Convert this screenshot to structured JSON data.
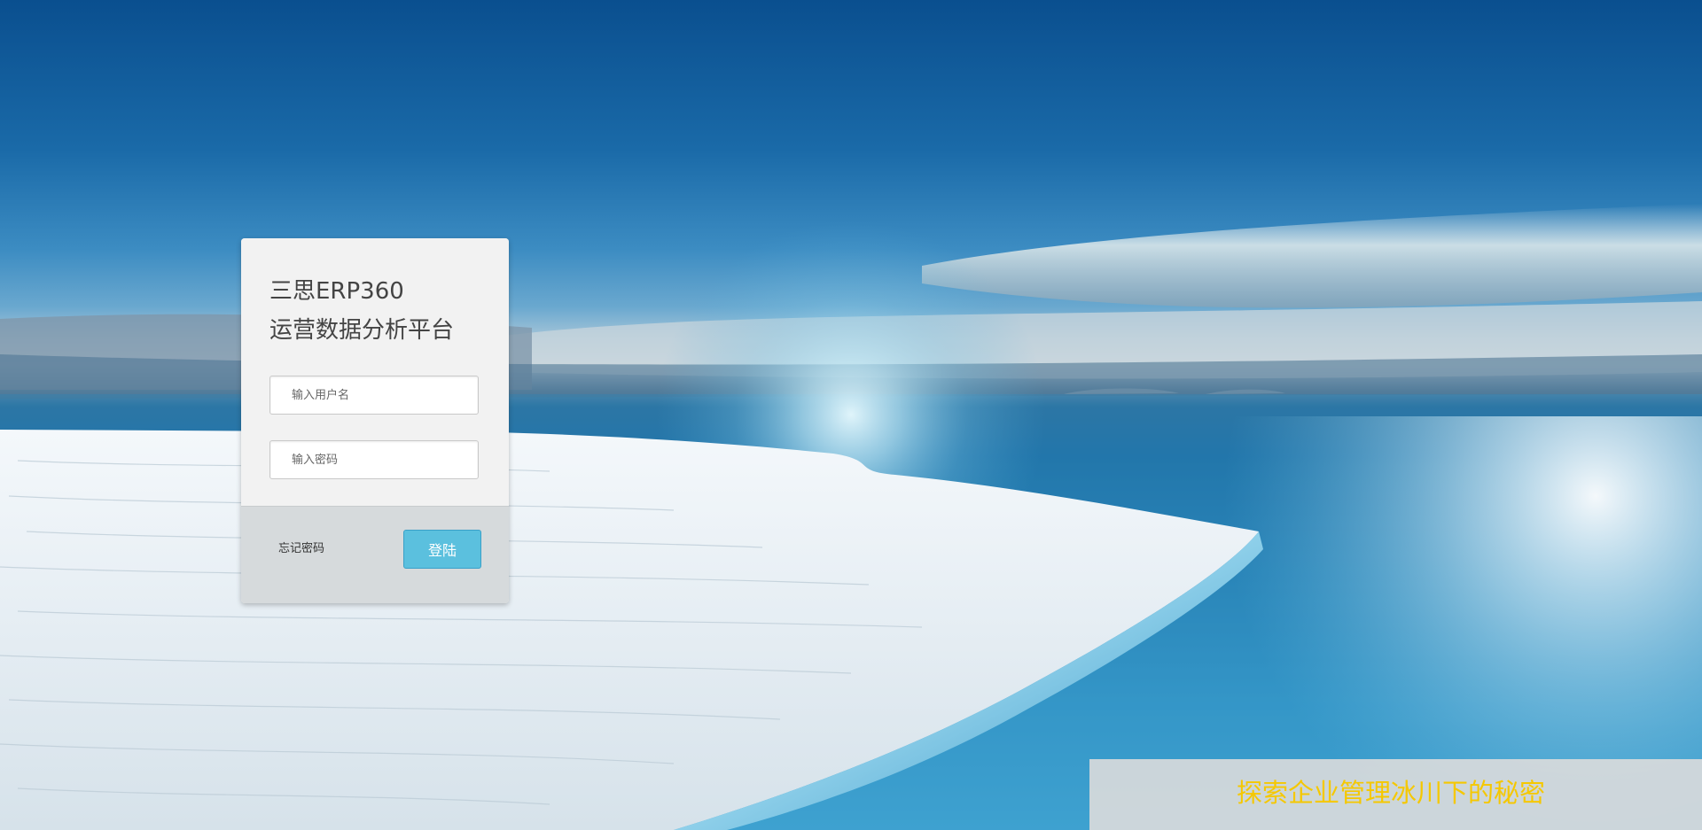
{
  "login": {
    "title_line1": "三思ERP360",
    "title_line2": "运营数据分析平台",
    "username_placeholder": "输入用户名",
    "password_placeholder": "输入密码",
    "forgot_label": "忘记密码",
    "login_label": "登陆"
  },
  "footer": {
    "slogan": "探索企业管理冰川下的秘密"
  },
  "colors": {
    "login_button": "#5bc0de",
    "slogan_text": "#f5c800",
    "card_bottom": "#d6dadc"
  }
}
